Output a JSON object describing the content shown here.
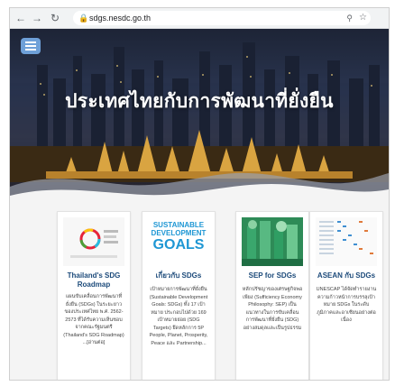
{
  "browser": {
    "url": "sdgs.nesdc.go.th"
  },
  "hero": {
    "title": "ประเทศไทยกับการพัฒนาที่ยั่งยืน"
  },
  "cards": [
    {
      "title_line1": "Thailand's SDG",
      "title_line2": "Roadmap",
      "body": "แผนขับเคลื่อนการพัฒนาที่ยั่งยืน (SDGs) ในระยะยาวของประเทศไทย พ.ศ. 2562-2573 ที่ได้รับความเห็นชอบจากคณะรัฐมนตรี (Thailand's SDG Roadmap) ...[อ่านต่อ]"
    },
    {
      "title_line1": "เกี่ยวกับ SDGs",
      "title_line2": "",
      "image_text": [
        "SUSTAINABLE",
        "DEVELOPMENT",
        "GOALS"
      ],
      "body": "เป้าหมายการพัฒนาที่ยั่งยืน (Sustainable Development Goals: SDGs) ทั้ง 17 เป้าหมาย ประกอบไปด้วย 169 เป้าหมายย่อย (SDG Targets) ยึดหลักการ 5P People, Planet, Prosperity, Peace และ Partnership..."
    },
    {
      "title_line1": "SEP for SDGs",
      "title_line2": "",
      "body": "หลักปรัชญาของเศรษฐกิจพอเพียง (Sufficiency Economy Philosophy: SEP) เป็นแนวทางในการขับเคลื่อนการพัฒนาที่ยั่งยืน (SDG) อย่างสมดุลและเป็นรูปธรรม"
    },
    {
      "title_line1": "ASEAN กับ SDGs",
      "title_line2": "",
      "body": "UNESCAP ได้จัดทำรายงานความก้าวหน้าการบรรลุเป้าหมาย SDGs ในระดับภูมิภาคและอาเซียนอย่างต่อเนื่อง"
    }
  ]
}
